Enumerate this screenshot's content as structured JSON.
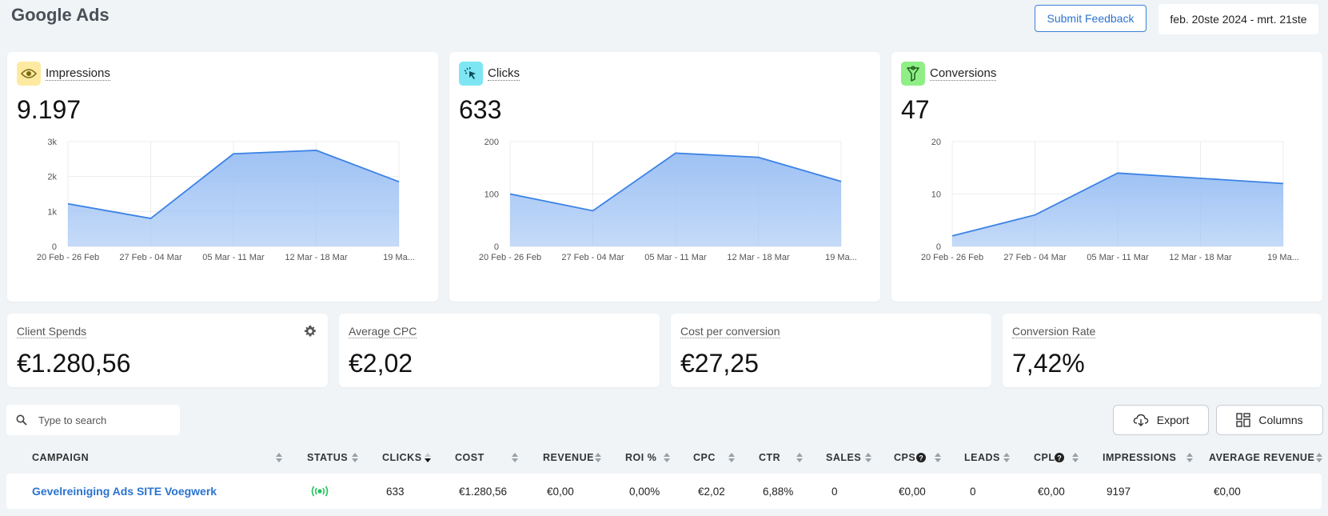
{
  "header": {
    "title": "Google Ads",
    "feedback_label": "Submit Feedback",
    "date_range": "feb. 20ste 2024 - mrt. 21ste"
  },
  "charts": [
    {
      "label": "Impressions",
      "value": "9.197",
      "icon": "eye-icon",
      "icon_bg": "#fdeaa0",
      "icon_color": "#7a6a12",
      "chart_data": {
        "type": "area",
        "categories": [
          "20 Feb - 26 Feb",
          "27 Feb - 04 Mar",
          "05 Mar - 11 Mar",
          "12 Mar - 18 Mar",
          "19 Ma..."
        ],
        "values": [
          1220,
          800,
          2650,
          2750,
          1850
        ],
        "ylim": [
          0,
          3000
        ],
        "yticks": [
          0,
          1000,
          2000,
          3000
        ],
        "ytick_labels": [
          "0",
          "1k",
          "2k",
          "3k"
        ],
        "grid": true,
        "title": "",
        "xlabel": "",
        "ylabel": ""
      }
    },
    {
      "label": "Clicks",
      "value": "633",
      "icon": "cursor-click-icon",
      "icon_bg": "#7ee6f3",
      "icon_color": "#0c4a5a",
      "chart_data": {
        "type": "area",
        "categories": [
          "20 Feb - 26 Feb",
          "27 Feb - 04 Mar",
          "05 Mar - 11 Mar",
          "12 Mar - 18 Mar",
          "19 Ma..."
        ],
        "values": [
          100,
          68,
          178,
          170,
          124
        ],
        "ylim": [
          0,
          200
        ],
        "yticks": [
          0,
          100,
          200
        ],
        "ytick_labels": [
          "0",
          "100",
          "200"
        ],
        "grid": true,
        "title": "",
        "xlabel": "",
        "ylabel": ""
      }
    },
    {
      "label": "Conversions",
      "value": "47",
      "icon": "funnel-icon",
      "icon_bg": "#8fef86",
      "icon_color": "#1f5a1a",
      "chart_data": {
        "type": "area",
        "categories": [
          "20 Feb - 26 Feb",
          "27 Feb - 04 Mar",
          "05 Mar - 11 Mar",
          "12 Mar - 18 Mar",
          "19 Ma..."
        ],
        "values": [
          2,
          6,
          14,
          13,
          12
        ],
        "ylim": [
          0,
          20
        ],
        "yticks": [
          0,
          10,
          20
        ],
        "ytick_labels": [
          "0",
          "10",
          "20"
        ],
        "grid": true,
        "title": "",
        "xlabel": "",
        "ylabel": ""
      }
    }
  ],
  "stats": [
    {
      "label": "Client Spends",
      "value": "€1.280,56"
    },
    {
      "label": "Average CPC",
      "value": "€2,02"
    },
    {
      "label": "Cost per conversion",
      "value": "€27,25"
    },
    {
      "label": "Conversion Rate",
      "value": "7,42%"
    }
  ],
  "toolbar": {
    "search_placeholder": "Type to search",
    "export_label": "Export",
    "columns_label": "Columns"
  },
  "table": {
    "columns": [
      "CAMPAIGN",
      "STATUS",
      "CLICKS",
      "COST",
      "REVENUE",
      "ROI %",
      "CPC",
      "CTR",
      "SALES",
      "CPS",
      "LEADS",
      "CPL",
      "IMPRESSIONS",
      "AVERAGE REVENUE"
    ],
    "sorted_column": "CLICKS",
    "sort_direction": "descending",
    "rows": [
      {
        "campaign": "Gevelreiniging Ads SITE Voegwerk",
        "status": "active-broadcast-icon",
        "clicks": "633",
        "cost": "€1.280,56",
        "revenue": "€0,00",
        "roi": "0,00%",
        "cpc": "€2,02",
        "ctr": "6,88%",
        "sales": "0",
        "cps": "€0,00",
        "leads": "0",
        "cpl": "€0,00",
        "impressions": "9197",
        "average_revenue": "€0,00"
      }
    ]
  },
  "colors": {
    "accent": "#2b74cf",
    "chart_line": "#3b82e6",
    "chart_fill_top": "#9ec2f4",
    "status_active": "#22c55e"
  }
}
